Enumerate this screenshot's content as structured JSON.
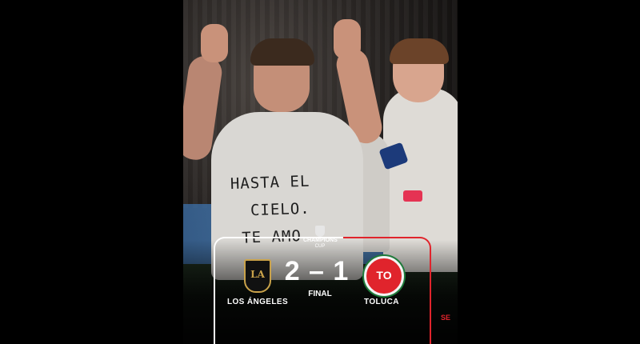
{
  "shirt_message": {
    "line1": "HASTA EL",
    "line2": "CIELO.",
    "line3": "TE AMO"
  },
  "tournament": {
    "line1": "CHAMPIONS",
    "line2": "CUP"
  },
  "match": {
    "home_team": "LOS ÁNGELES",
    "away_team": "TOLUCA",
    "score": "2 – 1",
    "status": "FINAL"
  },
  "crests": {
    "home_monogram": "LA",
    "away_monogram": "TO"
  },
  "corner_tag": "SE",
  "colors": {
    "accent_red": "#e0242c",
    "home_gold": "#c9a24a",
    "frame_white": "#ffffff"
  }
}
